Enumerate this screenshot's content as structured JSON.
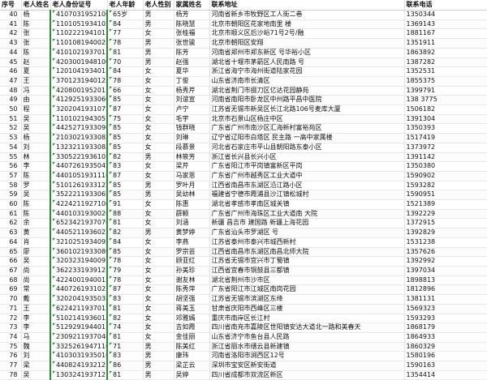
{
  "headers": [
    "序号",
    "老人姓名",
    "老人身份证号",
    "老人年龄",
    "老人性别",
    "家属姓名",
    "联系地址",
    "联系电话"
  ],
  "rows": [
    [
      "40",
      "杨",
      "4107031952100",
      "65岁",
      "男",
      "杨芳",
      "河南省新乡市牧野区工人街二巷",
      "1350344"
    ],
    [
      "41",
      "陈",
      "1101051934102",
      "84",
      "男",
      "陈晓慧",
      "北京市朝阳区花家地南里     楼",
      "1369143"
    ],
    [
      "42",
      "张",
      "1102221941011",
      "77",
      "女",
      "张桂福",
      "北京市顺义区后沙峪71号2号/融",
      "1881167"
    ],
    [
      "43",
      "张",
      "1101081940022",
      "78",
      "男",
      "张世骏",
      "北京市朝阳区安翔",
      "1351911"
    ],
    [
      "44",
      "陈",
      "4101021937011",
      "81",
      "男",
      "陈芳",
      "河南省郑州市郑东新区     号华裕小区",
      "1863892"
    ],
    [
      "45",
      "赵",
      "4203001948100",
      "70",
      "男",
      "赵强",
      "湖北省十堰市茅箭区人民南路     号",
      "1387282"
    ],
    [
      "46",
      "夏",
      "1201041934012",
      "84",
      "女",
      "夏华",
      "浙江省海宁市海州街道陆家花园",
      "1352531"
    ],
    [
      "47",
      "王",
      "3701231940123",
      "78",
      "女",
      "丁俊",
      "山东省济南市长清区",
      "1855375"
    ],
    [
      "48",
      "冯",
      "4208001952011",
      "66",
      "女",
      "杨秀芹",
      "湖北省荆门市掇刀区亿达花园静苑",
      "1399791"
    ],
    [
      "49",
      "由",
      "4129251933060",
      "85",
      "女",
      "刘谊宣",
      "河南省南阳市卧龙区中州路平昌中医院",
      "138 3775"
    ],
    [
      "50",
      "程",
      "3202041931072",
      "87",
      "女",
      "卢宁",
      "江苏省无锡市新吴区长江北路106号麦库大厦",
      "1506182"
    ],
    [
      "51",
      "吴",
      "1101021943051",
      "75",
      "女",
      "毛宇",
      "北京市石景山区杨庄中区",
      "1391304"
    ],
    [
      "52",
      "吴",
      "4425271933090",
      "85",
      "女",
      "钱群晓",
      "广东省广州市南沙区汇海新村富裕苑区",
      "1350393"
    ],
    [
      "53",
      "杨",
      "2103021933081",
      "85",
      "女",
      "刘琳",
      "辽宁省辽阳市白塔区     民主路          一高中家属楼",
      "1517419"
    ],
    [
      "54",
      "刘",
      "1323211933082",
      "85",
      "女",
      "段慕景",
      "河北省石家庄市平山县朝阳路东泰小区",
      "1373972"
    ],
    [
      "55",
      "林",
      "3305221936101",
      "82",
      "男",
      "林筱芳",
      "浙江省长兴县长兴小区",
      "1391142"
    ],
    [
      "56",
      "李",
      "4407261935042",
      "83",
      "女",
      "梁芹",
      "广东省阳江市平岗镇富新区平岗",
      "1350380"
    ],
    [
      "57",
      "陈",
      "4401051931110",
      "87",
      "女",
      "马家恩",
      "广东省广州市越秀区工业大道中",
      "1590902"
    ],
    [
      "58",
      "罗",
      "5101261933122",
      "85",
      "男",
      "罗叶月",
      "江西省南昌市东湖区沿江路小区",
      "1593282"
    ],
    [
      "59",
      "吴",
      "3522211933062",
      "85",
      "男",
      "吴幼林",
      "福建省宁德市霞浦县沙江镇松城村",
      "1590951"
    ],
    [
      "60",
      "陈",
      "4224211927100",
      "91",
      "女",
      "陈惠",
      "湖北省孝感市孝南区城关镇",
      "1521389"
    ],
    [
      "61",
      "陈",
      "4401031930020",
      "88",
      "女",
      "薛颖",
      "广东省广州市海珠区工业大道南     大院",
      "1392229"
    ],
    [
      "62",
      "余",
      "6523421937070",
      "81",
      "女",
      "刘涵",
      "新疆 昌吉市 建国路 新疆上海花园",
      "1372915"
    ],
    [
      "63",
      "黄",
      "4405211936022",
      "82",
      "男",
      "黄梦婷",
      "广东省汕头市罗湖区     号",
      "1392829"
    ],
    [
      "64",
      "肖",
      "3210251934092",
      "84",
      "女",
      "李燕",
      "江苏省泰州市泰兴市城西新村",
      "1531238"
    ],
    [
      "65",
      "廖",
      "3601021933080",
      "85",
      "女",
      "罗宗芸",
      "江西省南昌市东湖区南昌北师大院",
      "1357626"
    ],
    [
      "66",
      "吴",
      "3203231940091",
      "78",
      "女",
      "顾亚红",
      "江苏省无锡市宜兴市丁蜀镇",
      "1392992"
    ],
    [
      "67",
      "尚",
      "3622331939122",
      "79",
      "女",
      "孙美珍",
      "江西省宜春市铜鼓县三都镇",
      "1397034"
    ],
    [
      "68",
      "尚",
      "4224001940012",
      "78",
      "女",
      "谢友林",
      "湖北省荆州市沙市区",
      "1898813"
    ],
    [
      "69",
      "常",
      "4407261931021",
      "87",
      "女",
      "陈秀萍",
      "广东省阳江市江城区南岗花园",
      "1812896"
    ],
    [
      "70",
      "戴",
      "3202041935032",
      "83",
      "女",
      "胡坚强",
      "江苏省无锡市滨湖区东绛",
      "1381131"
    ],
    [
      "71",
      "王",
      "6224211937012",
      "81",
      "女",
      "蒋美玉",
      "甘肃省庆阳市西峰区三楼",
      "1569323"
    ],
    [
      "72",
      "李",
      "5102141936013",
      "82",
      "女",
      "邓雅嫣",
      "重庆市南岸区长江村",
      "1593293"
    ],
    [
      "73",
      "李",
      "5129291944011",
      "74",
      "女",
      "吉如霞",
      "四川省南充市嘉陵区世阳镇安达大道北一路和美春天",
      "1868179"
    ],
    [
      "74",
      "马",
      "2309211937040",
      "81",
      "女",
      "金佳丽",
      "山东省济宁市鱼台县人民路",
      "1864933"
    ],
    [
      "75",
      "魏",
      "3325261947110",
      "71",
      "男",
      "陈美红",
      "浙江省丽水市缙云县新建镇",
      "1860329"
    ],
    [
      "76",
      "刘",
      "4103031935010",
      "83",
      "男",
      "康玮",
      "河南省洛阳市涧西区12号",
      "1580196"
    ],
    [
      "77",
      "梁",
      "4408241932121",
      "86",
      "男",
      "梁芷云",
      "深圳市宝安区新安街道",
      "1590163"
    ],
    [
      "78",
      "吴",
      "1303241937121",
      "81",
      "男",
      "吴婷",
      "四川省成都市双流区新区",
      "1354414"
    ]
  ]
}
